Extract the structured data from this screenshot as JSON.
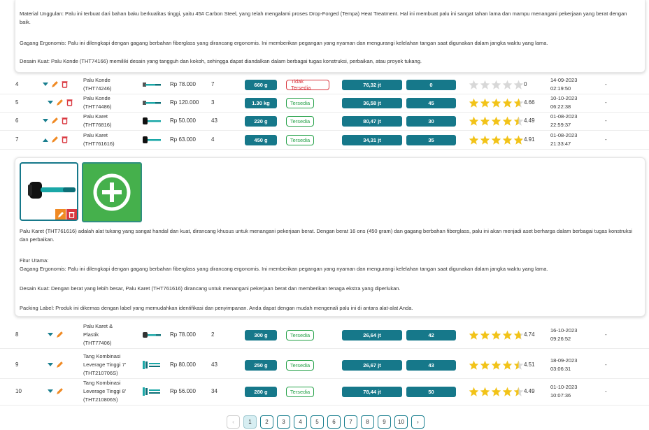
{
  "top_panel": {
    "para1": "Material Unggulan: Palu ini terbuat dari bahan baku berkualitas tinggi, yaitu 45# Carbon Steel, yang telah mengalami proses Drop-Forged (Tempa) Heat Treatment. Hal ini membuat palu ini sangat tahan lama dan mampu menangani pekerjaan yang berat dengan baik.",
    "para2": "Gagang Ergonomis: Palu ini dilengkapi dengan gagang berbahan fiberglass yang dirancang ergonomis. Ini memberikan pegangan yang nyaman dan mengurangi kelelahan tangan saat digunakan dalam jangka waktu yang lama.",
    "para3": "Desain Kuat: Palu Konde (THT74166) memiliki desain yang tangguh dan kokoh, sehingga dapat diandalkan dalam berbagai tugas konstruksi, perbaikan, atau proyek tukang."
  },
  "rows_a": [
    {
      "num": "4",
      "name1": "Palu Konde",
      "name2": "(THT74246)",
      "name3": "",
      "price": "Rp 78.000",
      "stock": "7",
      "weight": "660 g",
      "status": "Tidak Tersedia",
      "available": false,
      "sales": "76,32 jt",
      "qty": "0",
      "rating": "0",
      "stars": 0,
      "date": "14-09-2023",
      "time": "02:19:50",
      "extra": "-",
      "img": "hammer-icon",
      "expanded": false
    },
    {
      "num": "5",
      "name1": "Palu Konde",
      "name2": "(THT74486)",
      "name3": "",
      "price": "Rp 120.000",
      "stock": "3",
      "weight": "1.30 kg",
      "status": "Tersedia",
      "available": true,
      "sales": "36,58 jt",
      "qty": "45",
      "rating": "4.66",
      "stars": 4.66,
      "date": "10-10-2023",
      "time": "06:22:38",
      "extra": "-",
      "img": "hammer-icon",
      "expanded": false
    },
    {
      "num": "6",
      "name1": "Palu Karet",
      "name2": "(THT76816)",
      "name3": "",
      "price": "Rp 50.000",
      "stock": "43",
      "weight": "220 g",
      "status": "Tersedia",
      "available": true,
      "sales": "80,47 jt",
      "qty": "30",
      "rating": "4.49",
      "stars": 4.49,
      "date": "01-08-2023",
      "time": "22:59:37",
      "extra": "-",
      "img": "rubber-mallet-icon",
      "expanded": false
    },
    {
      "num": "7",
      "name1": "Palu Karet",
      "name2": "(THT761616)",
      "name3": "",
      "price": "Rp 63.000",
      "stock": "4",
      "weight": "450 g",
      "status": "Tersedia",
      "available": true,
      "sales": "34,31 jt",
      "qty": "35",
      "rating": "4.91",
      "stars": 4.91,
      "date": "01-08-2023",
      "time": "21:33:47",
      "extra": "-",
      "img": "rubber-mallet-icon",
      "expanded": true
    }
  ],
  "detail_panel": {
    "desc": "Palu Karet (THT761616) adalah alat tukang yang sangat handal dan kuat, dirancang khusus untuk menangani pekerjaan berat. Dengan berat 16 ons (450 gram) dan gagang berbahan fiberglass, palu ini akan menjadi aset berharga dalam berbagai tugas konstruksi dan perbaikan.",
    "features_title": "Fitur Utama:",
    "feat1": "Gagang Ergonomis: Palu ini dilengkapi dengan gagang berbahan fiberglass yang dirancang ergonomis. Ini memberikan pegangan yang nyaman dan mengurangi kelelahan tangan saat digunakan dalam jangka waktu yang lama.",
    "feat2": "Desain Kuat: Dengan berat yang lebih besar, Palu Karet (THT761616) dirancang untuk menangani pekerjaan berat dan memberikan tenaga ekstra yang diperlukan.",
    "feat3": "Packing Label: Produk ini dikemas dengan label yang memudahkan identifikasi dan penyimpanan. Anda dapat dengan mudah mengenali palu ini di antara alat-alat Anda.",
    "image_icon": "rubber-mallet-icon",
    "add_icon": "plus-circle-icon"
  },
  "rows_b": [
    {
      "num": "8",
      "name1": "Palu Karet &",
      "name2": "Plastik",
      "name3": "(THT77406)",
      "price": "Rp 78.000",
      "stock": "2",
      "weight": "300 g",
      "status": "Tersedia",
      "available": true,
      "sales": "26,64 jt",
      "qty": "42",
      "rating": "4.74",
      "stars": 4.74,
      "date": "16-10-2023",
      "time": "09:26:52",
      "extra": "-",
      "img": "mallet-icon"
    },
    {
      "num": "9",
      "name1": "Tang Kombinasi",
      "name2": "Leverage Tinggi 7'",
      "name3": "(THT210706S)",
      "price": "Rp 80.000",
      "stock": "43",
      "weight": "250 g",
      "status": "Tersedia",
      "available": true,
      "sales": "26,67 jt",
      "qty": "43",
      "rating": "4.51",
      "stars": 4.51,
      "date": "18-09-2023",
      "time": "03:06:31",
      "extra": "-",
      "img": "pliers-icon"
    },
    {
      "num": "10",
      "name1": "Tang Kombinasi",
      "name2": "Leverage Tinggi 8'",
      "name3": "(THT210806S)",
      "price": "Rp 56.000",
      "stock": "34",
      "weight": "280 g",
      "status": "Tersedia",
      "available": true,
      "sales": "78,44 jt",
      "qty": "50",
      "rating": "4.49",
      "stars": 4.49,
      "date": "01-10-2023",
      "time": "10:07:36",
      "extra": "-",
      "img": "pliers-icon"
    }
  ],
  "pagination": {
    "prev": "‹",
    "next": "›",
    "pages": [
      "1",
      "2",
      "3",
      "4",
      "5",
      "6",
      "7",
      "8",
      "9",
      "10"
    ],
    "active": "1"
  },
  "colors": {
    "teal": "#16788a",
    "star": "#f2c318",
    "star_empty": "#d8d8d8",
    "available": "#27a24a",
    "unavailable": "#d9363e",
    "edit": "#f08a24",
    "delete": "#d9363e",
    "add_button": "#45b04c"
  }
}
